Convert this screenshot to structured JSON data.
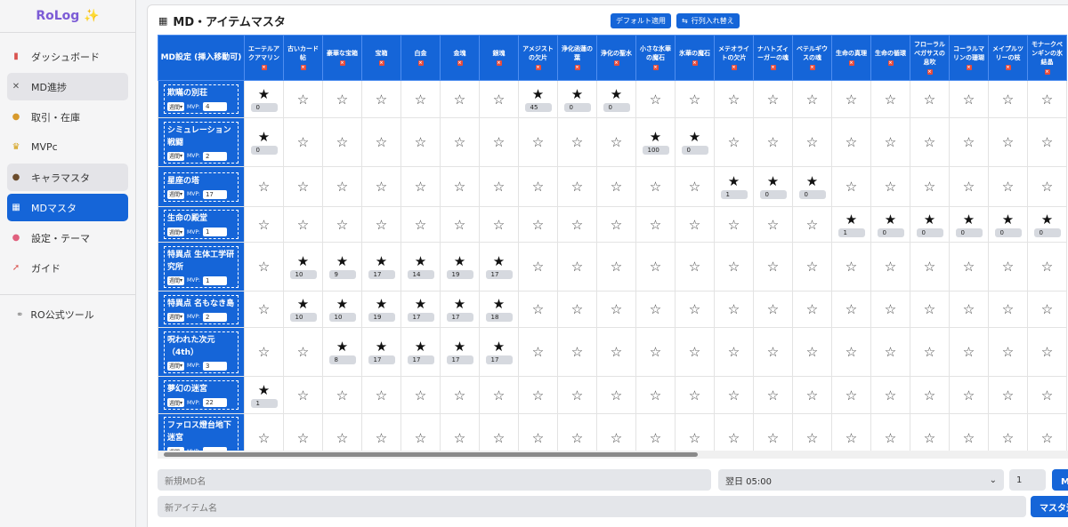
{
  "app": {
    "brand": "RoLog ✨"
  },
  "sidebar": {
    "items": [
      {
        "label": "ダッシュボード",
        "icon": "bar-chart-icon",
        "glyph": "▮",
        "color": "#d9534f"
      },
      {
        "label": "MD進捗",
        "icon": "swords-icon",
        "glyph": "✕",
        "color": "#555"
      },
      {
        "label": "取引・在庫",
        "icon": "money-bag-icon",
        "glyph": "●",
        "color": "#d89a2c"
      },
      {
        "label": "MVPc",
        "icon": "crown-icon",
        "glyph": "♛",
        "color": "#d4a017"
      },
      {
        "label": "キャラマスタ",
        "icon": "user-icon",
        "glyph": "●",
        "color": "#6b4c2c"
      },
      {
        "label": "MDマスタ",
        "icon": "calendar-icon",
        "glyph": "▦",
        "color": "#fff"
      },
      {
        "label": "設定・テーマ",
        "icon": "palette-icon",
        "glyph": "●",
        "color": "#e0607e"
      },
      {
        "label": "ガイド",
        "icon": "rocket-icon",
        "glyph": "➚",
        "color": "#d9534f"
      }
    ],
    "external": {
      "label": "RO公式ツール",
      "icon": "link-icon",
      "glyph": "⚭"
    }
  },
  "main": {
    "title": "MD・アイテムマスタ",
    "title_icon": "▦",
    "default_button": "デフォルト適用",
    "swap_button": "行列入れ替え",
    "swap_icon": "⇆",
    "corner_header": "MD設定 (挿入移動可)",
    "columns": [
      "エーテルアクアマリン",
      "古いカード帖",
      "豪華な宝箱",
      "宝箱",
      "白金",
      "金塊",
      "銀塊",
      "アメジストの欠片",
      "浄化函蓮の葉",
      "浄化の聖水",
      "小さな氷華の魔石",
      "氷華の魔石",
      "メテオライトの欠片",
      "ナハトズィーガーの魂",
      "ベテルギウスの魂",
      "生命の真理",
      "生命の循環",
      "フローラルベガサスの息吹",
      "コーラルマリンの珊瑚",
      "メイプルツリーの枝",
      "モナークペンギンの氷結晶"
    ],
    "rows": [
      {
        "name": "欺瞞の別荘",
        "period": "週間",
        "mvp_label": "MVP:",
        "mvp": "4",
        "stars": [
          {
            "col": 0,
            "count": "0"
          },
          {
            "col": 7,
            "count": "45"
          },
          {
            "col": 8,
            "count": "0"
          },
          {
            "col": 9,
            "count": "0"
          }
        ]
      },
      {
        "name": "シミュレーション戦闘",
        "period": "週間",
        "mvp_label": "MVP:",
        "mvp": "2",
        "stars": [
          {
            "col": 0,
            "count": "0"
          },
          {
            "col": 10,
            "count": "100"
          },
          {
            "col": 11,
            "count": "0"
          }
        ]
      },
      {
        "name": "星座の塔",
        "period": "週間",
        "mvp_label": "MVP:",
        "mvp": "17",
        "stars": [
          {
            "col": 12,
            "count": "1"
          },
          {
            "col": 13,
            "count": "0"
          },
          {
            "col": 14,
            "count": "0"
          }
        ]
      },
      {
        "name": "生命の殿堂",
        "period": "週間",
        "mvp_label": "MVP:",
        "mvp": "1",
        "stars": [
          {
            "col": 15,
            "count": "1"
          },
          {
            "col": 16,
            "count": "0"
          },
          {
            "col": 17,
            "count": "0"
          },
          {
            "col": 18,
            "count": "0"
          },
          {
            "col": 19,
            "count": "0"
          },
          {
            "col": 20,
            "count": "0"
          }
        ]
      },
      {
        "name": "特異点 生体工学研究所",
        "period": "週間",
        "mvp_label": "MVP:",
        "mvp": "1",
        "stars": [
          {
            "col": 1,
            "count": "10"
          },
          {
            "col": 2,
            "count": "9"
          },
          {
            "col": 3,
            "count": "17"
          },
          {
            "col": 4,
            "count": "14"
          },
          {
            "col": 5,
            "count": "19"
          },
          {
            "col": 6,
            "count": "17"
          }
        ]
      },
      {
        "name": "特異点 名もなき島",
        "period": "週間",
        "mvp_label": "MVP:",
        "mvp": "2",
        "stars": [
          {
            "col": 1,
            "count": "10"
          },
          {
            "col": 2,
            "count": "10"
          },
          {
            "col": 3,
            "count": "19"
          },
          {
            "col": 4,
            "count": "17"
          },
          {
            "col": 5,
            "count": "17"
          },
          {
            "col": 6,
            "count": "18"
          }
        ]
      },
      {
        "name": "呪われた次元（4th）",
        "period": "週間",
        "mvp_label": "MVP:",
        "mvp": "3",
        "stars": [
          {
            "col": 2,
            "count": "8"
          },
          {
            "col": 3,
            "count": "17"
          },
          {
            "col": 4,
            "count": "17"
          },
          {
            "col": 5,
            "count": "17"
          },
          {
            "col": 6,
            "count": "17"
          }
        ]
      },
      {
        "name": "夢幻の迷宮",
        "period": "週間",
        "mvp_label": "MVP:",
        "mvp": "22",
        "stars": [
          {
            "col": 0,
            "count": "1"
          }
        ]
      },
      {
        "name": "ファロス燈台地下迷宮",
        "period": "週間",
        "mvp_label": "MVP:",
        "mvp": "",
        "stars": []
      }
    ],
    "star_on": "★",
    "star_off": "☆",
    "delete_mark": "×"
  },
  "form": {
    "new_md_placeholder": "新規MD名",
    "reset_select": "翌日 05:00",
    "reset_caret": "⌄",
    "mvp_value": "1",
    "md_button": "MD追加",
    "new_item_placeholder": "新アイテム名",
    "item_button": "マスタ追加"
  }
}
